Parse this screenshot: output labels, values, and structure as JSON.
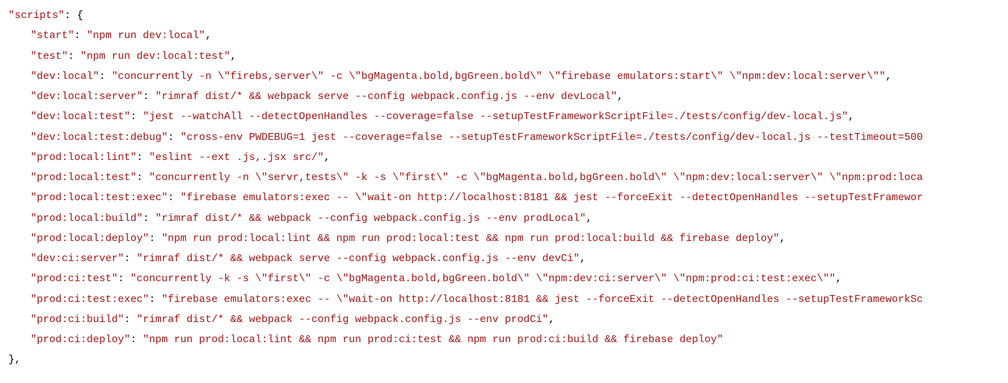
{
  "code": {
    "scripts_key": "\"scripts\"",
    "open_brace": ": {",
    "entries": [
      {
        "key": "\"start\"",
        "value": "\"npm run dev:local\""
      },
      {
        "key": "\"test\"",
        "value": "\"npm run dev:local:test\""
      },
      {
        "key": "\"dev:local\"",
        "value": "\"concurrently -n \\\"firebs,server\\\" -c \\\"bgMagenta.bold,bgGreen.bold\\\" \\\"firebase emulators:start\\\" \\\"npm:dev:local:server\\\"\""
      },
      {
        "key": "\"dev:local:server\"",
        "value": "\"rimraf dist/* && webpack serve --config webpack.config.js --env devLocal\""
      },
      {
        "key": "\"dev:local:test\"",
        "value": "\"jest --watchAll --detectOpenHandles --coverage=false --setupTestFrameworkScriptFile=./tests/config/dev-local.js\""
      },
      {
        "key": "\"dev:local:test:debug\"",
        "value": "\"cross-env PWDEBUG=1 jest --coverage=false --setupTestFrameworkScriptFile=./tests/config/dev-local.js --testTimeout=500"
      },
      {
        "key": "\"prod:local:lint\"",
        "value": "\"eslint --ext .js,.jsx src/\""
      },
      {
        "key": "\"prod:local:test\"",
        "value": "\"concurrently -n \\\"servr,tests\\\" -k -s \\\"first\\\" -c \\\"bgMagenta.bold,bgGreen.bold\\\" \\\"npm:dev:local:server\\\" \\\"npm:prod:loca"
      },
      {
        "key": "\"prod:local:test:exec\"",
        "value": "\"firebase emulators:exec -- \\\"wait-on http://localhost:8181 && jest --forceExit --detectOpenHandles --setupTestFramewor"
      },
      {
        "key": "\"prod:local:build\"",
        "value": "\"rimraf dist/* && webpack --config webpack.config.js --env prodLocal\""
      },
      {
        "key": "\"prod:local:deploy\"",
        "value": "\"npm run prod:local:lint && npm run prod:local:test && npm run prod:local:build && firebase deploy\""
      },
      {
        "key": "\"dev:ci:server\"",
        "value": "\"rimraf dist/* && webpack serve --config webpack.config.js --env devCi\""
      },
      {
        "key": "\"prod:ci:test\"",
        "value": "\"concurrently -k -s \\\"first\\\" -c \\\"bgMagenta.bold,bgGreen.bold\\\" \\\"npm:dev:ci:server\\\" \\\"npm:prod:ci:test:exec\\\"\""
      },
      {
        "key": "\"prod:ci:test:exec\"",
        "value": "\"firebase emulators:exec -- \\\"wait-on http://localhost:8181 && jest --forceExit --detectOpenHandles --setupTestFrameworkSc"
      },
      {
        "key": "\"prod:ci:build\"",
        "value": "\"rimraf dist/* && webpack --config webpack.config.js --env prodCi\""
      },
      {
        "key": "\"prod:ci:deploy\"",
        "value": "\"npm run prod:local:lint && npm run prod:ci:test && npm run prod:ci:build && firebase deploy\""
      }
    ],
    "close_brace": "},"
  }
}
